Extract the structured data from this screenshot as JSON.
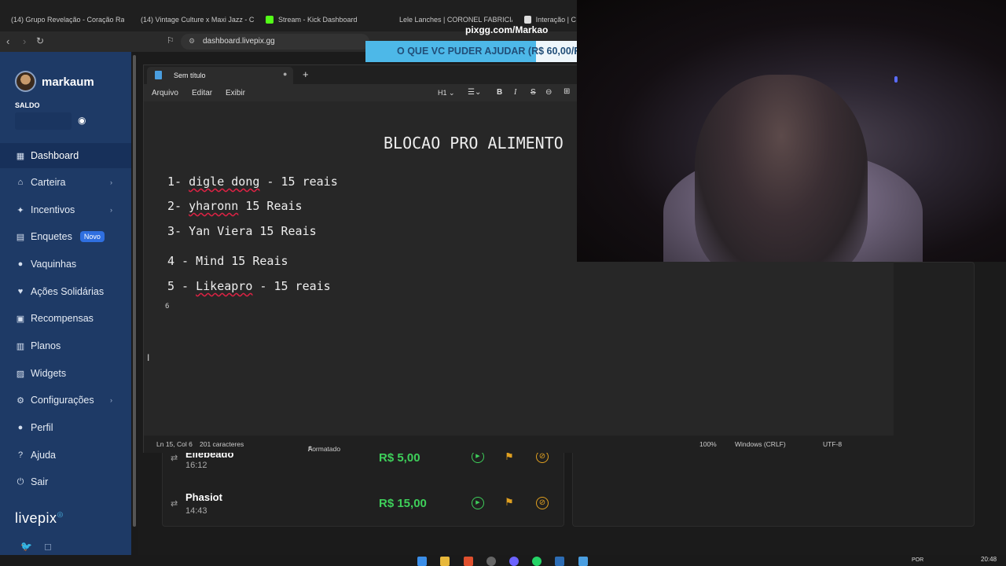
{
  "browser": {
    "tabs": [
      {
        "label": "(14) Grupo Revelação - Coração Radi",
        "color": "#ff0033"
      },
      {
        "label": "(14) Vintage Culture x Maxi Jazz - Co",
        "color": "#ff0033"
      },
      {
        "label": "Stream - Kick Dashboard",
        "color": "#53fc18"
      },
      {
        "label": "Lele Lanches | CORONEL FABRICIANO",
        "color": "#e84b4b"
      },
      {
        "label": "Interação | C",
        "color": "#dddddd"
      }
    ],
    "url": "dashboard.livepix.gg"
  },
  "sidebar": {
    "username": "markaum",
    "balance_label": "SALDO",
    "items": [
      {
        "label": "Dashboard",
        "icon": "grid-icon"
      },
      {
        "label": "Carteira",
        "icon": "bank-icon",
        "chevron": "›"
      },
      {
        "label": "Incentivos",
        "icon": "sparkle-icon",
        "chevron": "›"
      },
      {
        "label": "Enquetes",
        "icon": "poll-icon",
        "badge": "Novo"
      },
      {
        "label": "Vaquinhas",
        "icon": "piggy-icon"
      },
      {
        "label": "Ações Solidárias",
        "icon": "heart-hand-icon"
      },
      {
        "label": "Recompensas",
        "icon": "gift-icon"
      },
      {
        "label": "Planos",
        "icon": "layers-icon"
      },
      {
        "label": "Widgets",
        "icon": "widget-icon"
      },
      {
        "label": "Configurações",
        "icon": "gear-icon",
        "chevron": "›"
      },
      {
        "label": "Perfil",
        "icon": "user-icon"
      },
      {
        "label": "Ajuda",
        "icon": "help-icon"
      },
      {
        "label": "Sair",
        "icon": "logout-icon"
      }
    ],
    "brand": "livepix"
  },
  "donations": [
    {
      "name": "Ellebeado",
      "time": "16:12",
      "amount": "R$ 5,00"
    },
    {
      "name": "Phasiot",
      "time": "14:43",
      "amount": "R$ 15,00"
    }
  ],
  "notepad": {
    "tab_title": "Sem título",
    "menu": [
      "Arquivo",
      "Editar",
      "Exibir"
    ],
    "toolbar": {
      "heading": "H1"
    },
    "heading": "BLOCAO PRO ALIMENTO",
    "lines": [
      {
        "prefix": "1- ",
        "name": "digle dong",
        "suffix": " - 15 reais"
      },
      {
        "prefix": "2- ",
        "name": "yharonn",
        "suffix": " 15 Reais"
      },
      {
        "prefix": "3- ",
        "name": "Yan Viera",
        "suffix": " 15 Reais"
      },
      {
        "prefix": "4 - ",
        "name": "Mind",
        "suffix": " 15 Reais"
      },
      {
        "prefix": "5 - ",
        "name": "Likeapro",
        "suffix": " - 15 reais"
      }
    ],
    "line6": "6",
    "status": {
      "position": "Ln 15, Col 6",
      "chars": "201 caracteres",
      "format": "Formatado",
      "zoom": "100%",
      "eol": "Windows (CRLF)",
      "encoding": "UTF-8"
    }
  },
  "overlay": {
    "pix_url": "pixgg.com/Markao",
    "banner": "O QUE VC PUDER AJUDAR (R$ 60,00/R"
  },
  "taskbar": {
    "lang": "POR",
    "time": "20:48"
  }
}
